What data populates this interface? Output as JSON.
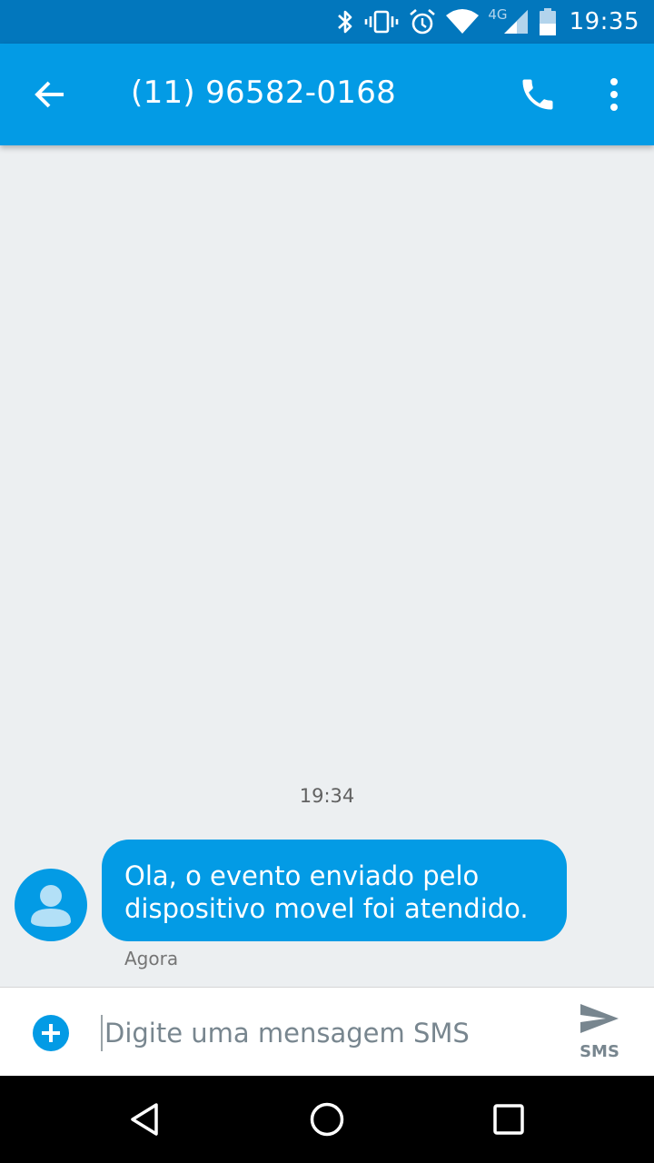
{
  "status_bar": {
    "network_label": "4G",
    "time": "19:35",
    "icons": [
      "bluetooth-icon",
      "vibrate-icon",
      "alarm-icon",
      "wifi-icon",
      "cell-signal-icon",
      "battery-icon"
    ]
  },
  "app_bar": {
    "title": "(11) 96582-0168",
    "icons": [
      "back-arrow-icon",
      "phone-icon",
      "more-vert-icon"
    ]
  },
  "thread": {
    "time_separator": "19:34",
    "messages": [
      {
        "lines": [
          "Ola, o evento enviado pelo",
          "dispositivo movel foi atendido."
        ],
        "timestamp": "Agora"
      }
    ]
  },
  "composer": {
    "placeholder": "Digite uma mensagem SMS",
    "send_label": "SMS"
  },
  "nav_bar": {
    "icons": [
      "back-triangle-icon",
      "home-circle-icon",
      "recents-square-icon"
    ]
  },
  "colors": {
    "status_bar": "#0277bd",
    "app_bar": "#039be5",
    "bubble": "#039be5",
    "background": "#eceff1"
  }
}
